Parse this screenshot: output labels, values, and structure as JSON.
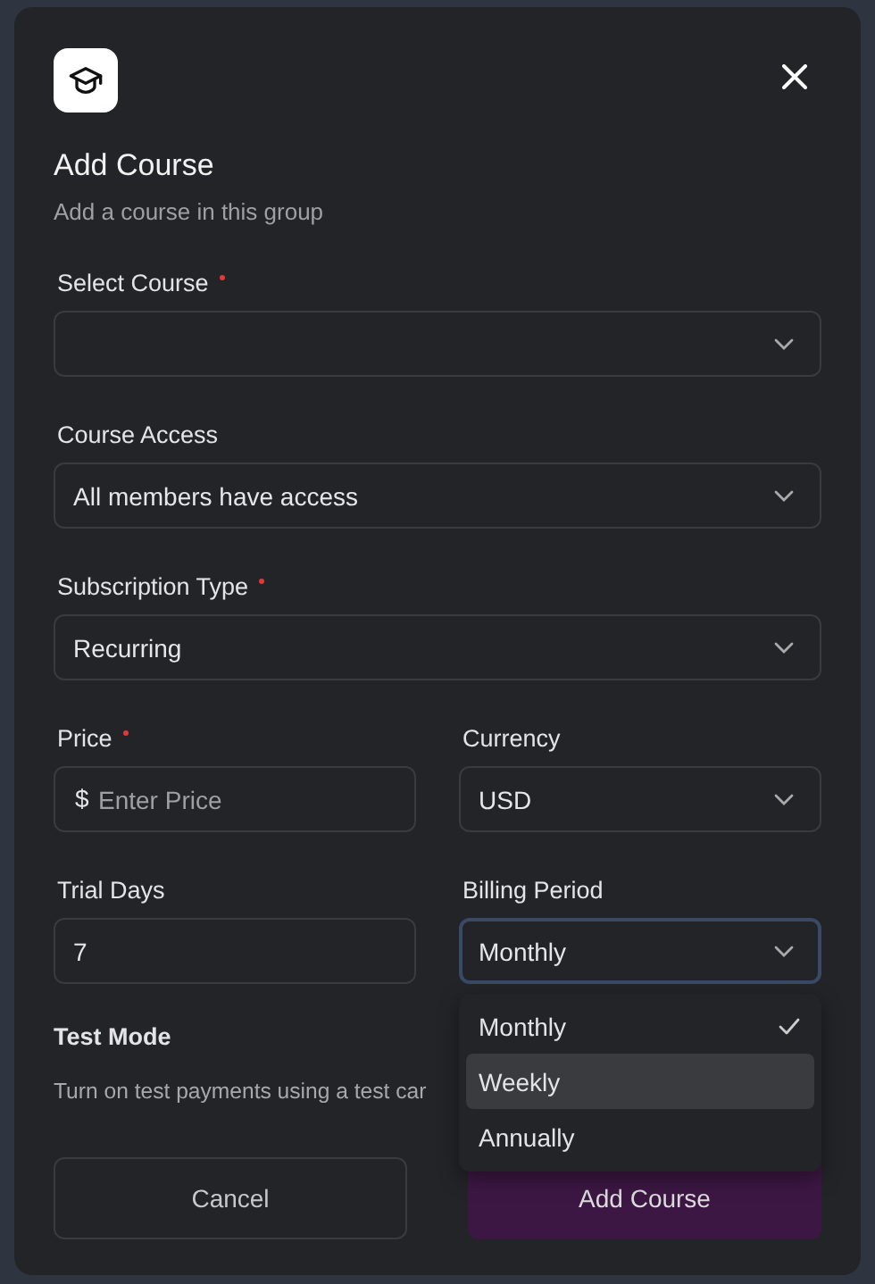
{
  "dialog": {
    "title": "Add Course",
    "subtitle": "Add a course in this group"
  },
  "rows": [
    [
      {
        "kind": "select",
        "label": "Select Course",
        "required": true,
        "focused": false
      }
    ],
    [
      {
        "kind": "select",
        "label": "Course Access",
        "value": "All members have access",
        "focused": false
      }
    ],
    [
      {
        "kind": "select",
        "label": "Subscription Type",
        "required": true,
        "value": "Recurring",
        "focused": false
      }
    ],
    [
      {
        "kind": "input",
        "label": "Price",
        "required": true,
        "prefix": "$",
        "placeholder": "Enter Price",
        "focused": false
      },
      {
        "kind": "select",
        "label": "Currency",
        "value": "USD",
        "focused": false
      }
    ],
    [
      {
        "kind": "input",
        "label": "Trial Days",
        "value": "7",
        "focused": false
      },
      {
        "kind": "select",
        "label": "Billing Period",
        "value": "Monthly",
        "focused": true,
        "options": [
          {
            "label": "Monthly",
            "selected": true,
            "hovered": false
          },
          {
            "label": "Weekly",
            "selected": false,
            "hovered": true
          },
          {
            "label": "Annually",
            "selected": false,
            "hovered": false
          }
        ]
      }
    ]
  ],
  "test_mode": {
    "label": "Test Mode",
    "description": "Turn on test payments using a test car"
  },
  "buttons": [
    {
      "kind": "secondary",
      "label": "Cancel"
    },
    {
      "kind": "primary",
      "label": "Add Course"
    }
  ]
}
